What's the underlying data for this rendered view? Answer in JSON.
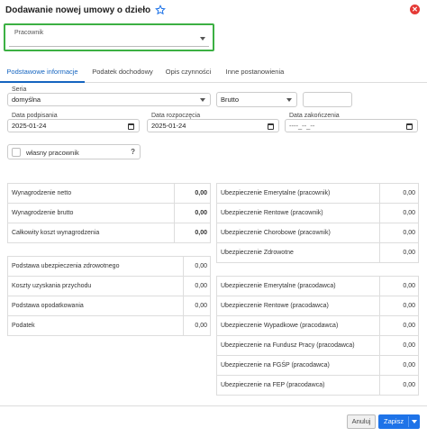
{
  "dialog": {
    "title": "Dodawanie nowej umowy o dzieło"
  },
  "worker": {
    "label": "Pracownik",
    "value": ""
  },
  "tabs": [
    {
      "label": "Podstawowe informacje"
    },
    {
      "label": "Podatek dochodowy"
    },
    {
      "label": "Opis czynności"
    },
    {
      "label": "Inne postanowienia"
    }
  ],
  "form": {
    "series_label": "Seria",
    "series_value": "domyślna",
    "gross_type": "Brutto",
    "amount": "",
    "signing_label": "Data podpisania",
    "signing_value": "2025-01-24",
    "start_label": "Data rozpoczęcia",
    "start_value": "2025-01-24",
    "end_label": "Data zakończenia",
    "end_placeholder": "----_--_--",
    "own_worker_label": "własny pracownik",
    "help": "?"
  },
  "summary": [
    {
      "label": "Wynagrodzenie netto",
      "value": "0,00"
    },
    {
      "label": "Wynagrodzenie brutto",
      "value": "0,00"
    },
    {
      "label": "Całkowity koszt wynagrodzenia",
      "value": "0,00"
    }
  ],
  "details": [
    {
      "label": "Podstawa ubezpieczenia zdrowotnego",
      "value": "0,00"
    },
    {
      "label": "Koszty uzyskania przychodu",
      "value": "0,00"
    },
    {
      "label": "Podstawa opodatkowania",
      "value": "0,00"
    },
    {
      "label": "Podatek",
      "value": "0,00"
    }
  ],
  "worker_contrib": [
    {
      "label": "Ubezpieczenie Emerytalne (pracownik)",
      "value": "0,00"
    },
    {
      "label": "Ubezpieczenie Rentowe (pracownik)",
      "value": "0,00"
    },
    {
      "label": "Ubezpieczenie Chorobowe (pracownik)",
      "value": "0,00"
    },
    {
      "label": "Ubezpieczenie Zdrowotne",
      "value": "0,00"
    }
  ],
  "employer_contrib": [
    {
      "label": "Ubezpieczenie Emerytalne (pracodawca)",
      "value": "0,00"
    },
    {
      "label": "Ubezpieczenie Rentowe (pracodawca)",
      "value": "0,00"
    },
    {
      "label": "Ubezpieczenie Wypadkowe (pracodawca)",
      "value": "0,00"
    },
    {
      "label": "Ubezpieczenie na Fundusz Pracy (pracodawca)",
      "value": "0,00"
    },
    {
      "label": "Ubezpieczenie na FGŚP (pracodawca)",
      "value": "0,00"
    },
    {
      "label": "Ubezpieczenie na FEP (pracodawca)",
      "value": "0,00"
    }
  ],
  "footer": {
    "cancel_label": "Anuluj",
    "save_label": "Zapisz"
  }
}
